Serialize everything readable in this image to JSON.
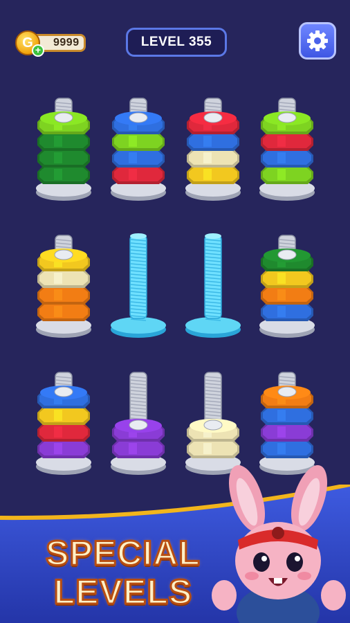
{
  "hud": {
    "coin_icon_letter": "G",
    "coin_count": "9999",
    "level_label": "LEVEL 355",
    "settings_icon": "gear-icon",
    "add_coins_icon": "plus-icon"
  },
  "board": {
    "rows": [
      [
        {
          "nuts": [
            "dark-green",
            "dark-green",
            "dark-green",
            "green"
          ]
        },
        {
          "nuts": [
            "red",
            "blue",
            "green",
            "blue"
          ]
        },
        {
          "nuts": [
            "yellow",
            "cream",
            "blue",
            "red"
          ]
        },
        {
          "nuts": [
            "green",
            "blue",
            "red",
            "green"
          ]
        }
      ],
      [
        {
          "nuts": [
            "orange",
            "orange",
            "cream",
            "yellow"
          ]
        },
        {
          "nuts": []
        },
        {
          "nuts": []
        },
        {
          "nuts": [
            "blue",
            "orange",
            "yellow",
            "dark-green"
          ]
        }
      ],
      [
        {
          "nuts": [
            "purple",
            "red",
            "yellow",
            "blue"
          ]
        },
        {
          "nuts": [
            "purple",
            "purple"
          ]
        },
        {
          "nuts": [
            "cream",
            "cream"
          ]
        },
        {
          "nuts": [
            "blue",
            "purple",
            "blue",
            "orange"
          ]
        }
      ]
    ]
  },
  "colors": {
    "green": "#7ed321",
    "dark-green": "#1f8a2e",
    "blue": "#2f6fe0",
    "red": "#e0283c",
    "yellow": "#f2c81f",
    "cream": "#ede3b4",
    "orange": "#f27d14",
    "purple": "#8a3cd6",
    "background": "#26255c",
    "banner": "#2f47c8"
  },
  "promo": {
    "line1": "SPECIAL",
    "line2": "LEVELS",
    "mascot": "bunny-mascot"
  }
}
